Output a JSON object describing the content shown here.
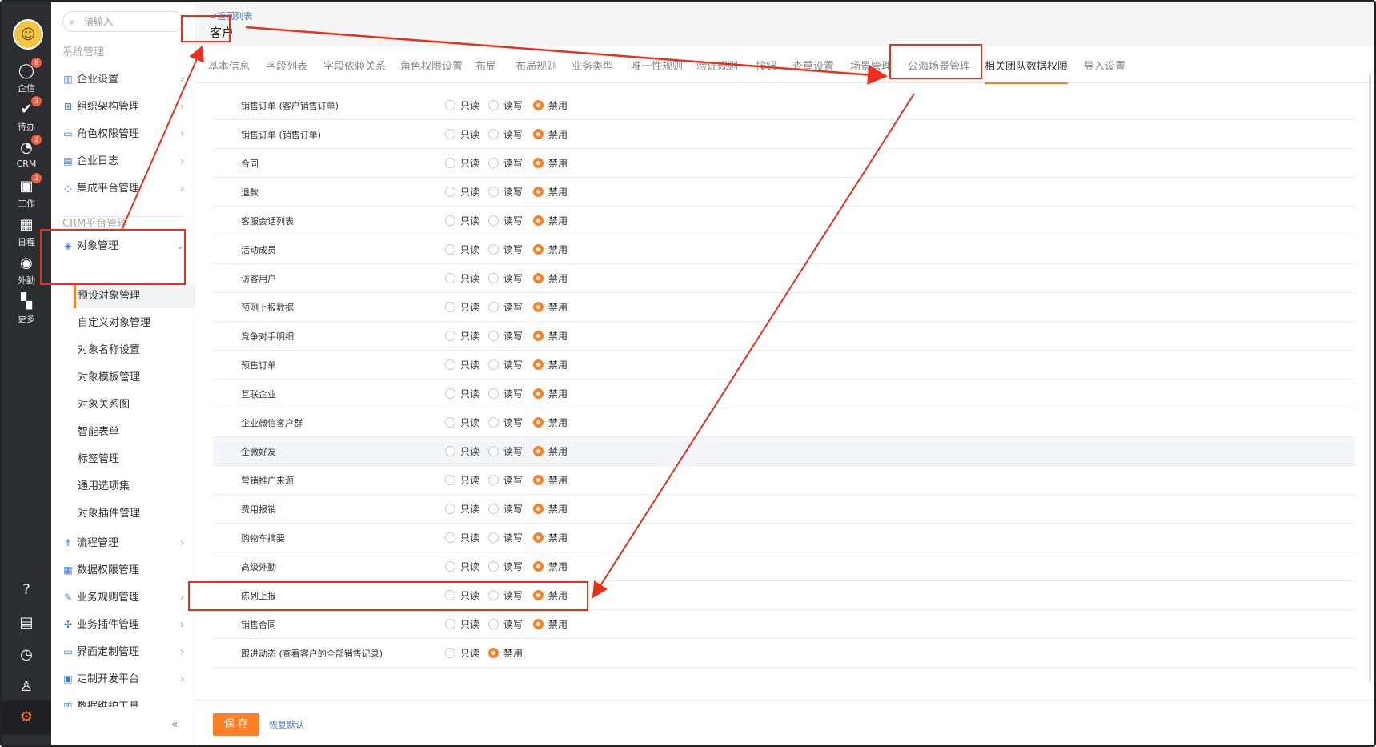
{
  "rail": {
    "items": [
      {
        "label": "企信",
        "icon": "chat-icon",
        "glyph": "◯",
        "badge": "8"
      },
      {
        "label": "待办",
        "icon": "check-icon",
        "glyph": "✔",
        "badge": "3"
      },
      {
        "label": "CRM",
        "icon": "crm-icon",
        "glyph": "◔",
        "badge": "2"
      },
      {
        "label": "工作",
        "icon": "work-icon",
        "glyph": "▣",
        "badge": "2"
      },
      {
        "label": "日程",
        "icon": "calendar-icon",
        "glyph": "▦",
        "badge": ""
      },
      {
        "label": "外勤",
        "icon": "location-icon",
        "glyph": "◉",
        "badge": ""
      },
      {
        "label": "更多",
        "icon": "more-icon",
        "glyph": "▚",
        "badge": ""
      }
    ],
    "bottom": [
      {
        "icon": "help-icon",
        "glyph": "?"
      },
      {
        "icon": "notes-icon",
        "glyph": "▤"
      },
      {
        "icon": "clock-icon",
        "glyph": "◷"
      },
      {
        "icon": "user-list-icon",
        "glyph": "♙"
      }
    ],
    "gear_glyph": "⚙"
  },
  "sidebar": {
    "search_placeholder": "请输入",
    "section1_title": "系统管理",
    "section1_items": [
      {
        "label": "企业设置",
        "icon": "building-icon",
        "glyph": "▥"
      },
      {
        "label": "组织架构管理",
        "icon": "org-icon",
        "glyph": "⊞"
      },
      {
        "label": "角色权限管理",
        "icon": "role-icon",
        "glyph": "▭"
      },
      {
        "label": "企业日志",
        "icon": "log-icon",
        "glyph": "▤"
      },
      {
        "label": "集成平台管理",
        "icon": "integration-icon",
        "glyph": "◇"
      }
    ],
    "section2_title": "CRM平台管理",
    "object_mgmt": {
      "label": "对象管理",
      "icon": "cube-icon",
      "glyph": "◈"
    },
    "object_sub_items": [
      "预设对象管理",
      "自定义对象管理",
      "对象名称设置",
      "对象模板管理",
      "对象关系图",
      "智能表单",
      "标签管理",
      "通用选项集",
      "对象插件管理"
    ],
    "section2_items": [
      {
        "label": "流程管理",
        "icon": "flow-icon",
        "glyph": "⋔",
        "chev": true
      },
      {
        "label": "数据权限管理",
        "icon": "data-permission-icon",
        "glyph": "▦",
        "chev": false
      },
      {
        "label": "业务规则管理",
        "icon": "rule-icon",
        "glyph": "✎",
        "chev": true
      },
      {
        "label": "业务插件管理",
        "icon": "plugin-icon",
        "glyph": "✣",
        "chev": true
      },
      {
        "label": "界面定制管理",
        "icon": "layout-icon",
        "glyph": "▭",
        "chev": true
      },
      {
        "label": "定制开发平台",
        "icon": "dev-icon",
        "glyph": "▣",
        "chev": true
      },
      {
        "label": "数据维护工具",
        "icon": "tool-icon",
        "glyph": "▥",
        "chev": false
      }
    ],
    "collapse_glyph": "«"
  },
  "header": {
    "back_link": "<返回列表",
    "title": "客户"
  },
  "tabs": [
    "基本信息",
    "字段列表",
    "字段依赖关系",
    "角色权限设置",
    "布局",
    "布局规则",
    "业务类型",
    "唯一性规则",
    "验证规则",
    "按钮",
    "查重设置",
    "场景管理",
    "公海场景管理",
    "相关团队数据权限",
    "导入设置"
  ],
  "active_tab": "相关团队数据权限",
  "options": {
    "read": "只读",
    "write": "读写",
    "disabled": "禁用"
  },
  "rows": [
    {
      "label": "销售订单 (客户销售订单)",
      "selected": "disabled"
    },
    {
      "label": "销售订单 (销售订单)",
      "selected": "disabled"
    },
    {
      "label": "合同",
      "selected": "disabled"
    },
    {
      "label": "退款",
      "selected": "disabled"
    },
    {
      "label": "客服会话列表",
      "selected": "disabled"
    },
    {
      "label": "活动成员",
      "selected": "disabled"
    },
    {
      "label": "访客用户",
      "selected": "disabled"
    },
    {
      "label": "预测上报数据",
      "selected": "disabled"
    },
    {
      "label": "竞争对手明细",
      "selected": "disabled"
    },
    {
      "label": "预售订单",
      "selected": "disabled"
    },
    {
      "label": "互联企业",
      "selected": "disabled"
    },
    {
      "label": "企业微信客户群",
      "selected": "disabled"
    },
    {
      "label": "企微好友",
      "selected": "disabled",
      "highlight": true
    },
    {
      "label": "营销推广来源",
      "selected": "disabled"
    },
    {
      "label": "费用报销",
      "selected": "disabled"
    },
    {
      "label": "购物车摘要",
      "selected": "disabled"
    },
    {
      "label": "高级外勤",
      "selected": "disabled"
    },
    {
      "label": "陈列上报",
      "selected": "disabled"
    },
    {
      "label": "销售合同",
      "selected": "disabled"
    },
    {
      "label": "跟进动态 (查看客户的全部销售记录)",
      "selected": "disabled",
      "no_write": true
    }
  ],
  "footer": {
    "save": "保 存",
    "reset": "恢复默认"
  },
  "colors": {
    "accent": "#ff7f24",
    "annotation": "#e8301c",
    "link": "#3a7bd5"
  }
}
